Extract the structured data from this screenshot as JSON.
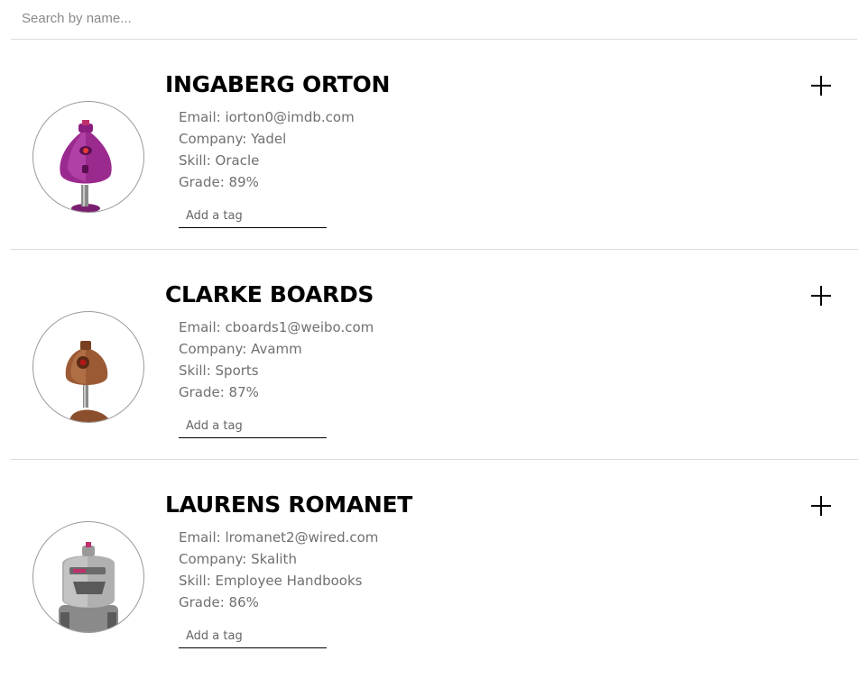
{
  "search": {
    "placeholder": "Search by name...",
    "value": ""
  },
  "tag_placeholder": "Add a tag",
  "students": [
    {
      "name": "INGABERG ORTON",
      "email": "Email: iorton0@imdb.com",
      "company": "Company: Yadel",
      "skill": "Skill: Oracle",
      "grade": "Grade: 89%",
      "avatar_color": "#9b2a8f",
      "avatar_icon": "robot-avatar-purple-icon"
    },
    {
      "name": "CLARKE BOARDS",
      "email": "Email: cboards1@weibo.com",
      "company": "Company: Avamm",
      "skill": "Skill: Sports",
      "grade": "Grade: 87%",
      "avatar_color": "#8c4f2e",
      "avatar_icon": "robot-avatar-brown-icon"
    },
    {
      "name": "LAURENS ROMANET",
      "email": "Email: lromanet2@wired.com",
      "company": "Company: Skalith",
      "skill": "Skill: Employee Handbooks",
      "grade": "Grade: 86%",
      "avatar_color": "#9a9a9a",
      "avatar_icon": "robot-avatar-gray-icon"
    }
  ],
  "icons": {
    "expand": "plus-icon"
  }
}
